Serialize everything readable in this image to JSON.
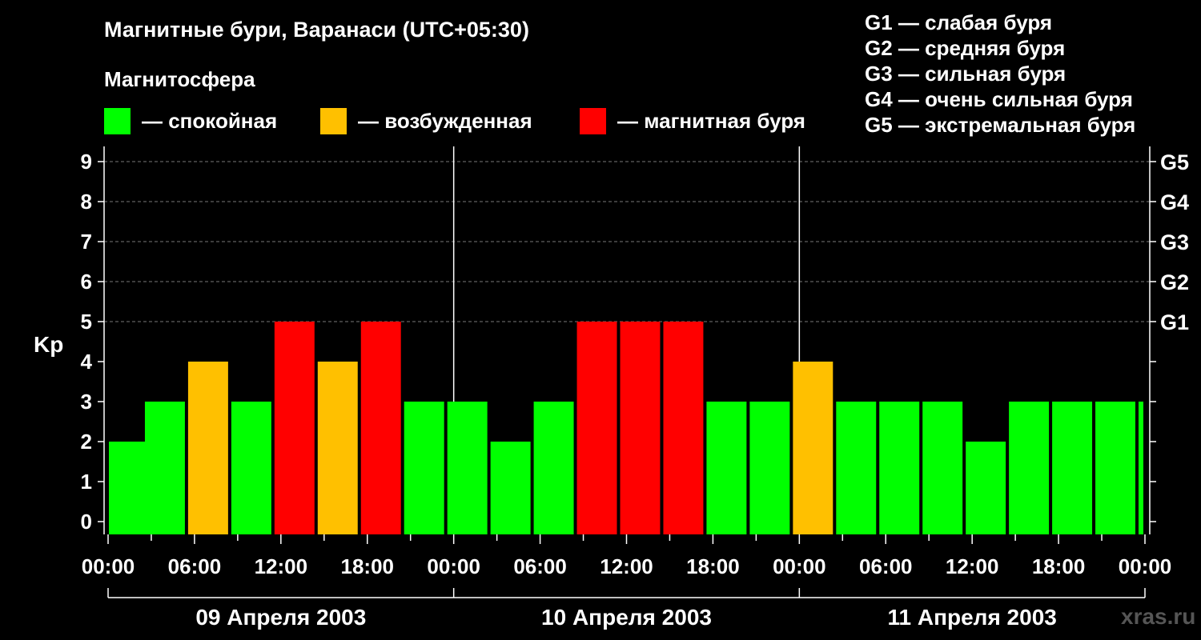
{
  "title": "Магнитные бури, Варанаси (UTC+05:30)",
  "subtitle": "Магнитосфера",
  "legend": [
    {
      "label": "— спокойная",
      "color": "#00ff00"
    },
    {
      "label": "— возбужденная",
      "color": "#ffc000"
    },
    {
      "label": "— магнитная буря",
      "color": "#ff0000"
    }
  ],
  "g_legend": [
    "G1 — слабая буря",
    "G2 — средняя буря",
    "G3 — сильная буря",
    "G4 — очень сильная буря",
    "G5 — экстремальная буря"
  ],
  "watermark": "xras.ru",
  "chart_data": {
    "type": "bar",
    "ylabel": "Kp",
    "ylim": [
      0,
      9
    ],
    "yticks": [
      "0",
      "1",
      "2",
      "3",
      "4",
      "5",
      "6",
      "7",
      "8",
      "9"
    ],
    "right_ticks": [
      {
        "kp": 5,
        "label": "G1"
      },
      {
        "kp": 6,
        "label": "G2"
      },
      {
        "kp": 7,
        "label": "G3"
      },
      {
        "kp": 8,
        "label": "G4"
      },
      {
        "kp": 9,
        "label": "G5"
      }
    ],
    "xticks": [
      "00:00",
      "06:00",
      "12:00",
      "18:00",
      "00:00",
      "06:00",
      "12:00",
      "18:00",
      "00:00",
      "06:00",
      "12:00",
      "18:00",
      "00:00"
    ],
    "days": [
      "09 Апреля 2003",
      "10 Апреля 2003",
      "11 Апреля 2003"
    ],
    "thresholds": {
      "excited": 4,
      "storm": 5
    },
    "bars": [
      {
        "start": "2003-04-09 00:00",
        "kp": 2
      },
      {
        "start": "2003-04-09 02:30",
        "kp": 3
      },
      {
        "start": "2003-04-09 05:30",
        "kp": 4
      },
      {
        "start": "2003-04-09 08:30",
        "kp": 3
      },
      {
        "start": "2003-04-09 11:30",
        "kp": 5
      },
      {
        "start": "2003-04-09 14:30",
        "kp": 4
      },
      {
        "start": "2003-04-09 17:30",
        "kp": 5
      },
      {
        "start": "2003-04-09 20:30",
        "kp": 3
      },
      {
        "start": "2003-04-09 23:30",
        "kp": 3
      },
      {
        "start": "2003-04-10 02:30",
        "kp": 2
      },
      {
        "start": "2003-04-10 05:30",
        "kp": 3
      },
      {
        "start": "2003-04-10 08:30",
        "kp": 5
      },
      {
        "start": "2003-04-10 11:30",
        "kp": 5
      },
      {
        "start": "2003-04-10 14:30",
        "kp": 5
      },
      {
        "start": "2003-04-10 17:30",
        "kp": 3
      },
      {
        "start": "2003-04-10 20:30",
        "kp": 3
      },
      {
        "start": "2003-04-10 23:30",
        "kp": 4
      },
      {
        "start": "2003-04-11 02:30",
        "kp": 3
      },
      {
        "start": "2003-04-11 05:30",
        "kp": 3
      },
      {
        "start": "2003-04-11 08:30",
        "kp": 3
      },
      {
        "start": "2003-04-11 11:30",
        "kp": 2
      },
      {
        "start": "2003-04-11 14:30",
        "kp": 3
      },
      {
        "start": "2003-04-11 17:30",
        "kp": 3
      },
      {
        "start": "2003-04-11 20:30",
        "kp": 3
      },
      {
        "start": "2003-04-11 23:30",
        "kp": 3
      }
    ]
  }
}
